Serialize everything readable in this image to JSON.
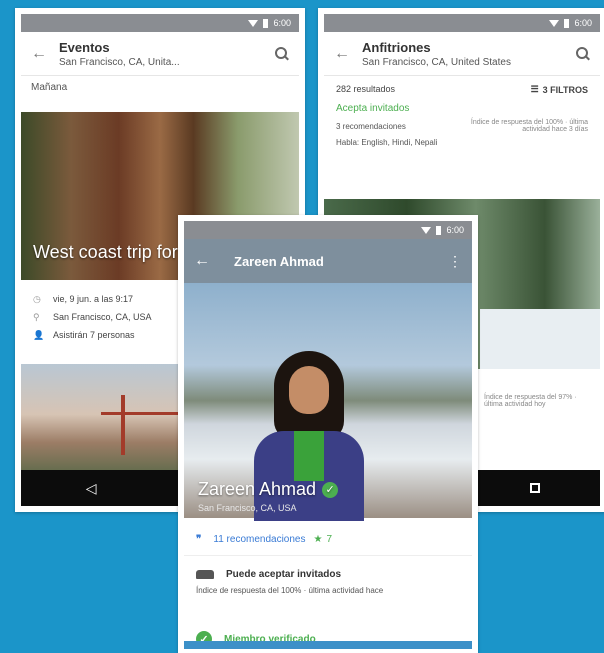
{
  "colors": {
    "background": "#1b95c9",
    "accent_green": "#4caf50",
    "link_blue": "#3a7bd5"
  },
  "left_phone": {
    "status_time": "6:00",
    "title": "Eventos",
    "subtitle": "San Francisco, CA, Unita...",
    "section_label": "Mañana",
    "event_title": "West coast trip for",
    "date": "vie, 9 jun. a las 9:17",
    "location": "San Francisco, CA, USA",
    "attendees": "Asistirán 7 personas",
    "nav": {
      "back": "◁",
      "home": "○"
    }
  },
  "right_phone": {
    "status_time": "6:00",
    "title": "Anfitriones",
    "subtitle": "San Francisco, CA, United States",
    "results": "282 resultados",
    "filters": "3 FILTROS",
    "accepts": "Acepta invitados",
    "recommendations": "3 recomendaciones",
    "response_rate": "Índice de respuesta del 100% · última actividad hace 3 días",
    "languages": "Habla: English, Hindi, Nepali",
    "lower_response": "Índice de respuesta del 97% · última actividad hoy"
  },
  "front_phone": {
    "status_time": "6:00",
    "name": "Zareen Ahmad",
    "hero_name": "Zareen Ahmad",
    "hero_location": "San Francisco, CA, USA",
    "recommendations": "11 recomendaciones",
    "star_count": "7",
    "accept_title": "Puede aceptar invitados",
    "accept_sub": "Índice de respuesta del 100% · última actividad hace",
    "verified": "Miembro verificado"
  }
}
